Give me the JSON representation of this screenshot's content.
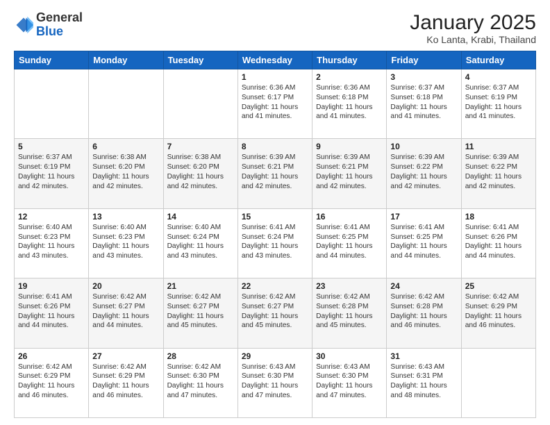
{
  "header": {
    "logo_general": "General",
    "logo_blue": "Blue",
    "month": "January 2025",
    "location": "Ko Lanta, Krabi, Thailand"
  },
  "days_of_week": [
    "Sunday",
    "Monday",
    "Tuesday",
    "Wednesday",
    "Thursday",
    "Friday",
    "Saturday"
  ],
  "weeks": [
    [
      {
        "day": "",
        "info": ""
      },
      {
        "day": "",
        "info": ""
      },
      {
        "day": "",
        "info": ""
      },
      {
        "day": "1",
        "info": "Sunrise: 6:36 AM\nSunset: 6:17 PM\nDaylight: 11 hours\nand 41 minutes."
      },
      {
        "day": "2",
        "info": "Sunrise: 6:36 AM\nSunset: 6:18 PM\nDaylight: 11 hours\nand 41 minutes."
      },
      {
        "day": "3",
        "info": "Sunrise: 6:37 AM\nSunset: 6:18 PM\nDaylight: 11 hours\nand 41 minutes."
      },
      {
        "day": "4",
        "info": "Sunrise: 6:37 AM\nSunset: 6:19 PM\nDaylight: 11 hours\nand 41 minutes."
      }
    ],
    [
      {
        "day": "5",
        "info": "Sunrise: 6:37 AM\nSunset: 6:19 PM\nDaylight: 11 hours\nand 42 minutes."
      },
      {
        "day": "6",
        "info": "Sunrise: 6:38 AM\nSunset: 6:20 PM\nDaylight: 11 hours\nand 42 minutes."
      },
      {
        "day": "7",
        "info": "Sunrise: 6:38 AM\nSunset: 6:20 PM\nDaylight: 11 hours\nand 42 minutes."
      },
      {
        "day": "8",
        "info": "Sunrise: 6:39 AM\nSunset: 6:21 PM\nDaylight: 11 hours\nand 42 minutes."
      },
      {
        "day": "9",
        "info": "Sunrise: 6:39 AM\nSunset: 6:21 PM\nDaylight: 11 hours\nand 42 minutes."
      },
      {
        "day": "10",
        "info": "Sunrise: 6:39 AM\nSunset: 6:22 PM\nDaylight: 11 hours\nand 42 minutes."
      },
      {
        "day": "11",
        "info": "Sunrise: 6:39 AM\nSunset: 6:22 PM\nDaylight: 11 hours\nand 42 minutes."
      }
    ],
    [
      {
        "day": "12",
        "info": "Sunrise: 6:40 AM\nSunset: 6:23 PM\nDaylight: 11 hours\nand 43 minutes."
      },
      {
        "day": "13",
        "info": "Sunrise: 6:40 AM\nSunset: 6:23 PM\nDaylight: 11 hours\nand 43 minutes."
      },
      {
        "day": "14",
        "info": "Sunrise: 6:40 AM\nSunset: 6:24 PM\nDaylight: 11 hours\nand 43 minutes."
      },
      {
        "day": "15",
        "info": "Sunrise: 6:41 AM\nSunset: 6:24 PM\nDaylight: 11 hours\nand 43 minutes."
      },
      {
        "day": "16",
        "info": "Sunrise: 6:41 AM\nSunset: 6:25 PM\nDaylight: 11 hours\nand 44 minutes."
      },
      {
        "day": "17",
        "info": "Sunrise: 6:41 AM\nSunset: 6:25 PM\nDaylight: 11 hours\nand 44 minutes."
      },
      {
        "day": "18",
        "info": "Sunrise: 6:41 AM\nSunset: 6:26 PM\nDaylight: 11 hours\nand 44 minutes."
      }
    ],
    [
      {
        "day": "19",
        "info": "Sunrise: 6:41 AM\nSunset: 6:26 PM\nDaylight: 11 hours\nand 44 minutes."
      },
      {
        "day": "20",
        "info": "Sunrise: 6:42 AM\nSunset: 6:27 PM\nDaylight: 11 hours\nand 44 minutes."
      },
      {
        "day": "21",
        "info": "Sunrise: 6:42 AM\nSunset: 6:27 PM\nDaylight: 11 hours\nand 45 minutes."
      },
      {
        "day": "22",
        "info": "Sunrise: 6:42 AM\nSunset: 6:27 PM\nDaylight: 11 hours\nand 45 minutes."
      },
      {
        "day": "23",
        "info": "Sunrise: 6:42 AM\nSunset: 6:28 PM\nDaylight: 11 hours\nand 45 minutes."
      },
      {
        "day": "24",
        "info": "Sunrise: 6:42 AM\nSunset: 6:28 PM\nDaylight: 11 hours\nand 46 minutes."
      },
      {
        "day": "25",
        "info": "Sunrise: 6:42 AM\nSunset: 6:29 PM\nDaylight: 11 hours\nand 46 minutes."
      }
    ],
    [
      {
        "day": "26",
        "info": "Sunrise: 6:42 AM\nSunset: 6:29 PM\nDaylight: 11 hours\nand 46 minutes."
      },
      {
        "day": "27",
        "info": "Sunrise: 6:42 AM\nSunset: 6:29 PM\nDaylight: 11 hours\nand 46 minutes."
      },
      {
        "day": "28",
        "info": "Sunrise: 6:42 AM\nSunset: 6:30 PM\nDaylight: 11 hours\nand 47 minutes."
      },
      {
        "day": "29",
        "info": "Sunrise: 6:43 AM\nSunset: 6:30 PM\nDaylight: 11 hours\nand 47 minutes."
      },
      {
        "day": "30",
        "info": "Sunrise: 6:43 AM\nSunset: 6:30 PM\nDaylight: 11 hours\nand 47 minutes."
      },
      {
        "day": "31",
        "info": "Sunrise: 6:43 AM\nSunset: 6:31 PM\nDaylight: 11 hours\nand 48 minutes."
      },
      {
        "day": "",
        "info": ""
      }
    ]
  ]
}
